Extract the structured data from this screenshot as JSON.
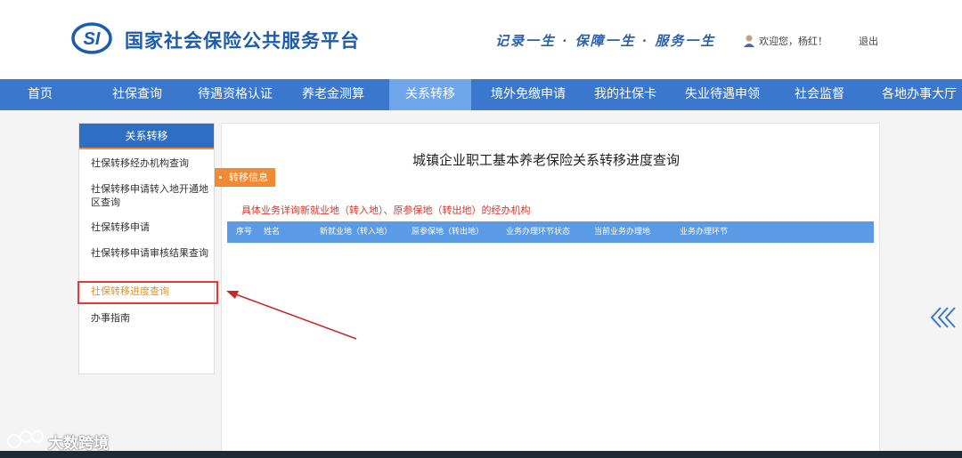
{
  "header": {
    "site_title": "国家社会保险公共服务平台",
    "slogan": "记录一生 · 保障一生 · 服务一生",
    "welcome": "欢迎您，杨红！",
    "logout": "退出",
    "logo_text": "SI"
  },
  "nav": {
    "items": [
      {
        "label": "首页"
      },
      {
        "label": "社保查询"
      },
      {
        "label": "待遇资格认证"
      },
      {
        "label": "养老金测算"
      },
      {
        "label": "关系转移"
      },
      {
        "label": "境外免缴申请"
      },
      {
        "label": "我的社保卡"
      },
      {
        "label": "失业待遇申领"
      },
      {
        "label": "社会监督"
      },
      {
        "label": "各地办事大厅"
      }
    ],
    "active_index": 4
  },
  "sidebar": {
    "title": "关系转移",
    "items": [
      {
        "label": "社保转移经办机构查询"
      },
      {
        "label": "社保转移申请转入地开通地区查询"
      },
      {
        "label": "社保转移申请"
      },
      {
        "label": "社保转移申请审核结果查询"
      },
      {
        "label": "社保转移进度查询"
      },
      {
        "label": "办事指南"
      }
    ],
    "active_index": 4
  },
  "main": {
    "title": "城镇企业职工基本养老保险关系转移进度查询",
    "tag": "转移信息",
    "notice": "具体业务详询新就业地（转入地）、原参保地（转出地）的经办机构",
    "columns": [
      "序号",
      "姓名",
      "新就业地（转入地）",
      "原参保地（转出地）",
      "业务办理环节状态",
      "当前业务办理地",
      "业务办理环节"
    ]
  },
  "watermark": {
    "text": "大数跨境"
  },
  "colors": {
    "brand_blue": "#3b78cd",
    "nav_active": "#6fa5ea",
    "accent_orange": "#f08a33",
    "alert_red": "#d9342b",
    "table_head": "#5b9ae5"
  },
  "icons": {
    "logo": "si-logo-icon",
    "user": "user-icon",
    "collapse": "double-chevron-left-icon",
    "annotation": "red-arrow-annotation"
  }
}
